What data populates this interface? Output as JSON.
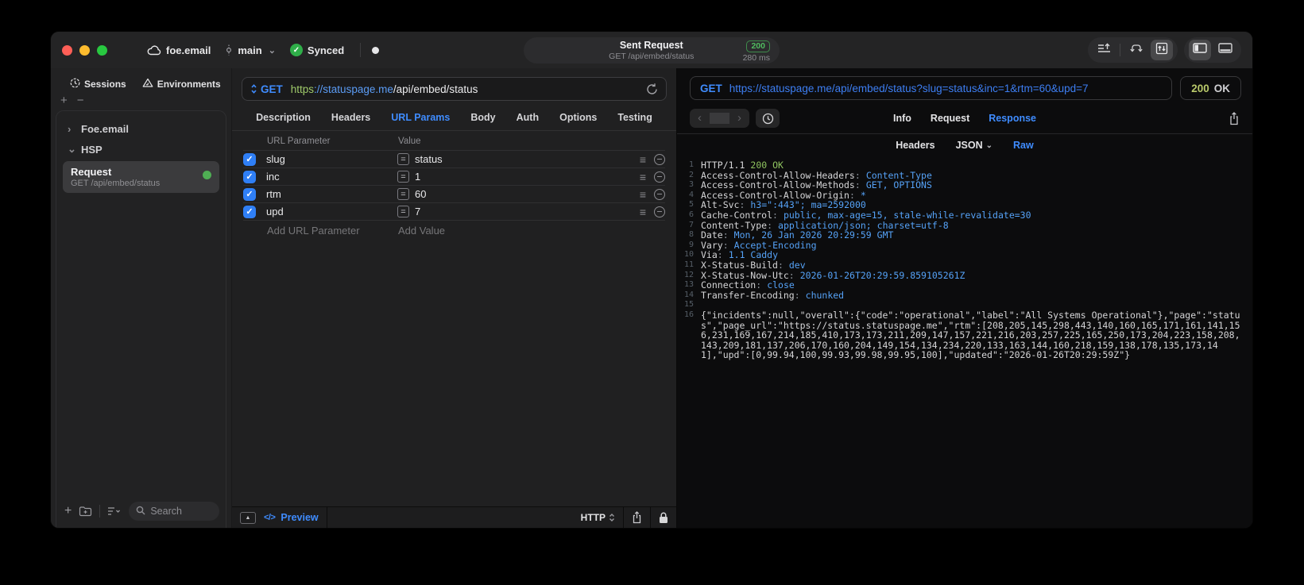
{
  "glyphs": {
    "chevron_right": "›",
    "chevron_down": "⌄",
    "back": "‹",
    "forward": "›",
    "plus": "+",
    "minus": "−",
    "check": "✓",
    "hamburger": "≡",
    "eq": "=",
    "collapse_up": "▲",
    "code_tag": "</>"
  },
  "titlebar": {
    "project": "foe.email",
    "branch": "main",
    "sync_status": "Synced",
    "center": {
      "title": "Sent Request",
      "subtitle": "GET /api/embed/status",
      "status_code": "200",
      "duration": "280 ms"
    }
  },
  "sidebar": {
    "tabs": [
      {
        "label": "Sessions"
      },
      {
        "label": "Environments"
      }
    ],
    "tree": [
      {
        "label": "Foe.email"
      },
      {
        "label": "HSP"
      }
    ],
    "request_item": {
      "title": "Request",
      "subtitle": "GET /api/embed/status"
    },
    "search_placeholder": "Search"
  },
  "request_pane": {
    "method": "GET",
    "url_scheme": "https",
    "url_host": "://statuspage.me",
    "url_path": "/api/embed/status",
    "tabs": [
      "Description",
      "Headers",
      "URL Params",
      "Body",
      "Auth",
      "Options",
      "Testing"
    ],
    "active_tab": "URL Params",
    "param_table": {
      "columns": [
        "URL Parameter",
        "Value"
      ],
      "rows": [
        {
          "name": "slug",
          "value": "status",
          "enabled": true
        },
        {
          "name": "inc",
          "value": "1",
          "enabled": true
        },
        {
          "name": "rtm",
          "value": "60",
          "enabled": true
        },
        {
          "name": "upd",
          "value": "7",
          "enabled": true
        }
      ],
      "add_param_placeholder": "Add URL Parameter",
      "add_value_placeholder": "Add Value"
    },
    "footer": {
      "preview_label": "Preview",
      "protocol": "HTTP"
    }
  },
  "response_pane": {
    "method": "GET",
    "url": "https://statuspage.me/api/embed/status?slug=status&inc=1&rtm=60&upd=7",
    "status_code": "200",
    "status_text": "OK",
    "tabs": [
      "Info",
      "Request",
      "Response"
    ],
    "active_tab": "Response",
    "subtabs": [
      "Headers",
      "JSON",
      "Raw"
    ],
    "active_subtab": "Raw",
    "code": {
      "status_line": {
        "num": "1",
        "protocol": "HTTP/1.1",
        "status": "200 OK"
      },
      "headers": [
        {
          "num": "2",
          "name": "Access-Control-Allow-Headers",
          "value": "Content-Type"
        },
        {
          "num": "3",
          "name": "Access-Control-Allow-Methods",
          "value": "GET, OPTIONS"
        },
        {
          "num": "4",
          "name": "Access-Control-Allow-Origin",
          "value": "*"
        },
        {
          "num": "5",
          "name": "Alt-Svc",
          "value": "h3=\":443\"; ma=2592000"
        },
        {
          "num": "6",
          "name": "Cache-Control",
          "value": "public, max-age=15, stale-while-revalidate=30"
        },
        {
          "num": "7",
          "name": "Content-Type",
          "value": "application/json; charset=utf-8"
        },
        {
          "num": "8",
          "name": "Date",
          "value": "Mon, 26 Jan 2026 20:29:59 GMT"
        },
        {
          "num": "9",
          "name": "Vary",
          "value": "Accept-Encoding"
        },
        {
          "num": "10",
          "name": "Via",
          "value": "1.1 Caddy"
        },
        {
          "num": "11",
          "name": "X-Status-Build",
          "value": "dev"
        },
        {
          "num": "12",
          "name": "X-Status-Now-Utc",
          "value": "2026-01-26T20:29:59.859105261Z"
        },
        {
          "num": "13",
          "name": "Connection",
          "value": "close"
        },
        {
          "num": "14",
          "name": "Transfer-Encoding",
          "value": "chunked"
        }
      ],
      "blank_line_num": "15",
      "body_line_num": "16",
      "body": "{\"incidents\":null,\"overall\":{\"code\":\"operational\",\"label\":\"All Systems Operational\"},\"page\":\"status\",\"page_url\":\"https://status.statuspage.me\",\"rtm\":[208,205,145,298,443,140,160,165,171,161,141,156,231,169,167,214,185,410,173,173,211,209,147,157,221,216,203,257,225,165,250,173,204,223,158,208,143,209,181,137,206,170,160,204,149,154,134,234,220,133,163,144,160,218,159,138,178,135,173,141],\"upd\":[0,99.94,100,99.93,99.98,99.95,100],\"updated\":\"2026-01-26T20:29:59Z\"}"
    }
  }
}
